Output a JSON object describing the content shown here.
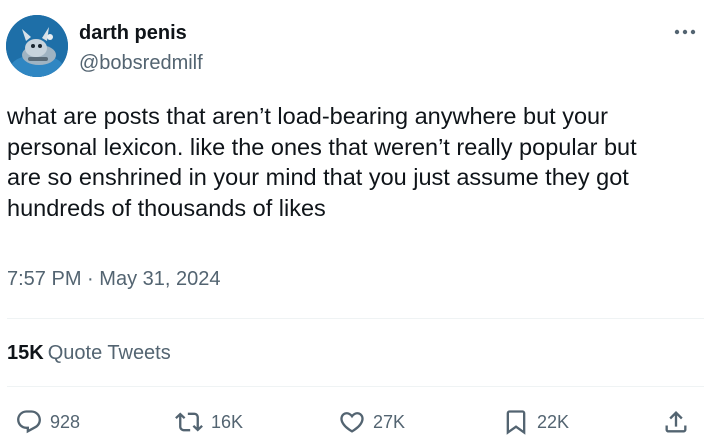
{
  "author": {
    "display_name": "darth penis",
    "handle": "@bobsredmilf",
    "avatar_icon": "avatar-cartoon-icon"
  },
  "tweet": {
    "lines": [
      "what are posts that aren’t load-bearing anywhere but your",
      "personal lexicon. like the ones that weren’t really popular but",
      "are so enshrined  in your mind that you just assume they got",
      "hundreds of thousands of likes"
    ],
    "time": "7:57 PM",
    "separator": "·",
    "date": "May 31, 2024"
  },
  "quote_tweets": {
    "count": "15K",
    "label": "Quote Tweets"
  },
  "actions": {
    "reply": {
      "icon": "reply-icon",
      "count": "928"
    },
    "retweet": {
      "icon": "retweet-icon",
      "count": "16K"
    },
    "like": {
      "icon": "heart-icon",
      "count": "27K"
    },
    "bookmark": {
      "icon": "bookmark-icon",
      "count": "22K"
    },
    "share": {
      "icon": "share-icon"
    }
  },
  "more_icon": "more-options-icon",
  "colors": {
    "text_primary": "#0f1419",
    "text_secondary": "#536471",
    "divider": "#eff3f4",
    "avatar_bg": "#1e6fa8"
  }
}
